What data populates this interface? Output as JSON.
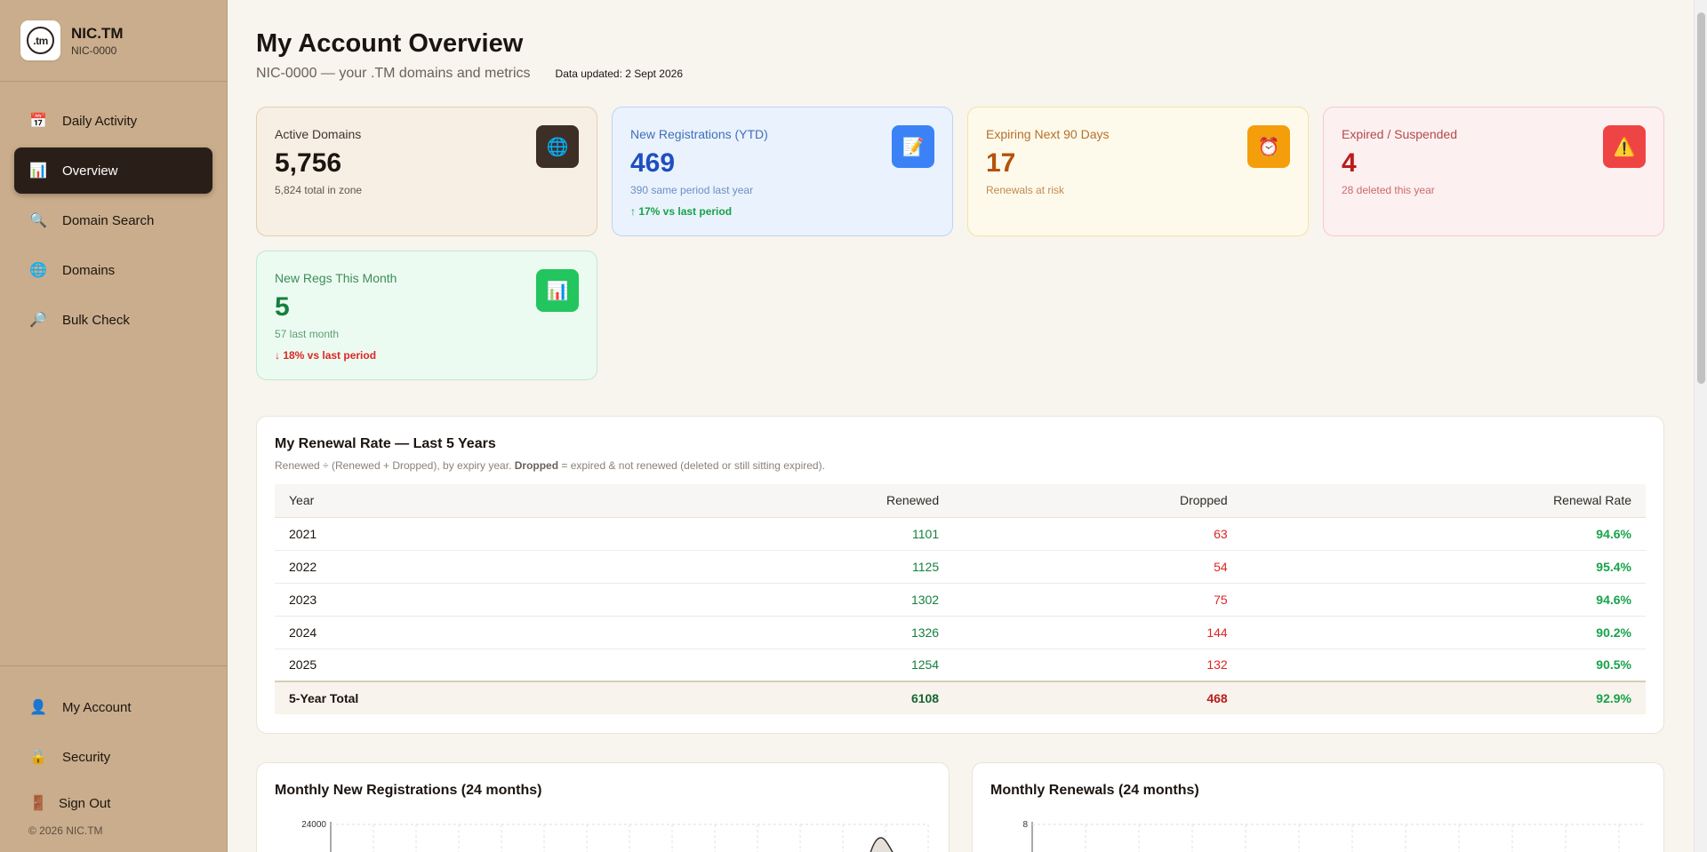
{
  "brand": {
    "logo_text": ".tm",
    "name": "NIC.TM",
    "id": "NIC-0000"
  },
  "sidebar": {
    "items": [
      {
        "icon": "calendar-icon",
        "glyph": "📅",
        "label": "Daily Activity"
      },
      {
        "icon": "bar-chart-icon",
        "glyph": "📊",
        "label": "Overview",
        "active": true
      },
      {
        "icon": "search-icon",
        "glyph": "🔍",
        "label": "Domain Search"
      },
      {
        "icon": "globe-icon",
        "glyph": "🌐",
        "label": "Domains"
      },
      {
        "icon": "magnifier-icon",
        "glyph": "🔎",
        "label": "Bulk Check"
      }
    ],
    "bottom_items": [
      {
        "icon": "user-icon",
        "glyph": "👤",
        "label": "My Account"
      },
      {
        "icon": "lock-icon",
        "glyph": "🔒",
        "label": "Security"
      },
      {
        "icon": "door-icon",
        "glyph": "🚪",
        "label": "Sign Out"
      }
    ],
    "copyright": "© 2026 NIC.TM"
  },
  "header": {
    "title": "My Account Overview",
    "subtitle": "NIC-0000 — your .TM domains and metrics",
    "updated": "Data updated: 2 Sept 2026"
  },
  "cards": [
    {
      "label": "Active Domains",
      "value": "5,756",
      "sub": "5,824 total in zone",
      "icon": "globe-icon",
      "glyph": "🌐"
    },
    {
      "label": "New Registrations (YTD)",
      "value": "469",
      "sub": "390 same period last year",
      "trend": "↑ 17% vs last period",
      "icon": "memo-icon",
      "glyph": "📝"
    },
    {
      "label": "Expiring Next 90 Days",
      "value": "17",
      "sub": "Renewals at risk",
      "icon": "alarm-clock-icon",
      "glyph": "⏰"
    },
    {
      "label": "Expired / Suspended",
      "value": "4",
      "sub": "28 deleted this year",
      "icon": "warning-icon",
      "glyph": "⚠️"
    },
    {
      "label": "New Regs This Month",
      "value": "5",
      "sub": "57 last month",
      "trend": "↓ 18% vs last period",
      "icon": "bar-chart-icon",
      "glyph": "📊"
    }
  ],
  "renewal": {
    "title": "My Renewal Rate — Last 5 Years",
    "note_prefix": "Renewed ÷ (Renewed + Dropped), by expiry year. ",
    "note_bold": "Dropped",
    "note_suffix": " = expired & not renewed (deleted or still sitting expired).",
    "columns": [
      "Year",
      "Renewed",
      "Dropped",
      "Renewal Rate"
    ],
    "rows": [
      {
        "year": "2021",
        "renewed": "1101",
        "dropped": "63",
        "rate": "94.6%"
      },
      {
        "year": "2022",
        "renewed": "1125",
        "dropped": "54",
        "rate": "95.4%"
      },
      {
        "year": "2023",
        "renewed": "1302",
        "dropped": "75",
        "rate": "94.6%"
      },
      {
        "year": "2024",
        "renewed": "1326",
        "dropped": "144",
        "rate": "90.2%"
      },
      {
        "year": "2025",
        "renewed": "1254",
        "dropped": "132",
        "rate": "90.5%"
      }
    ],
    "total": {
      "year": "5-Year Total",
      "renewed": "6108",
      "dropped": "468",
      "rate": "92.9%"
    }
  },
  "charts": [
    {
      "title": "Monthly New Registrations (24 months)",
      "y_max_label": "24000"
    },
    {
      "title": "Monthly Renewals (24 months)",
      "y_max_label": "8"
    }
  ]
}
